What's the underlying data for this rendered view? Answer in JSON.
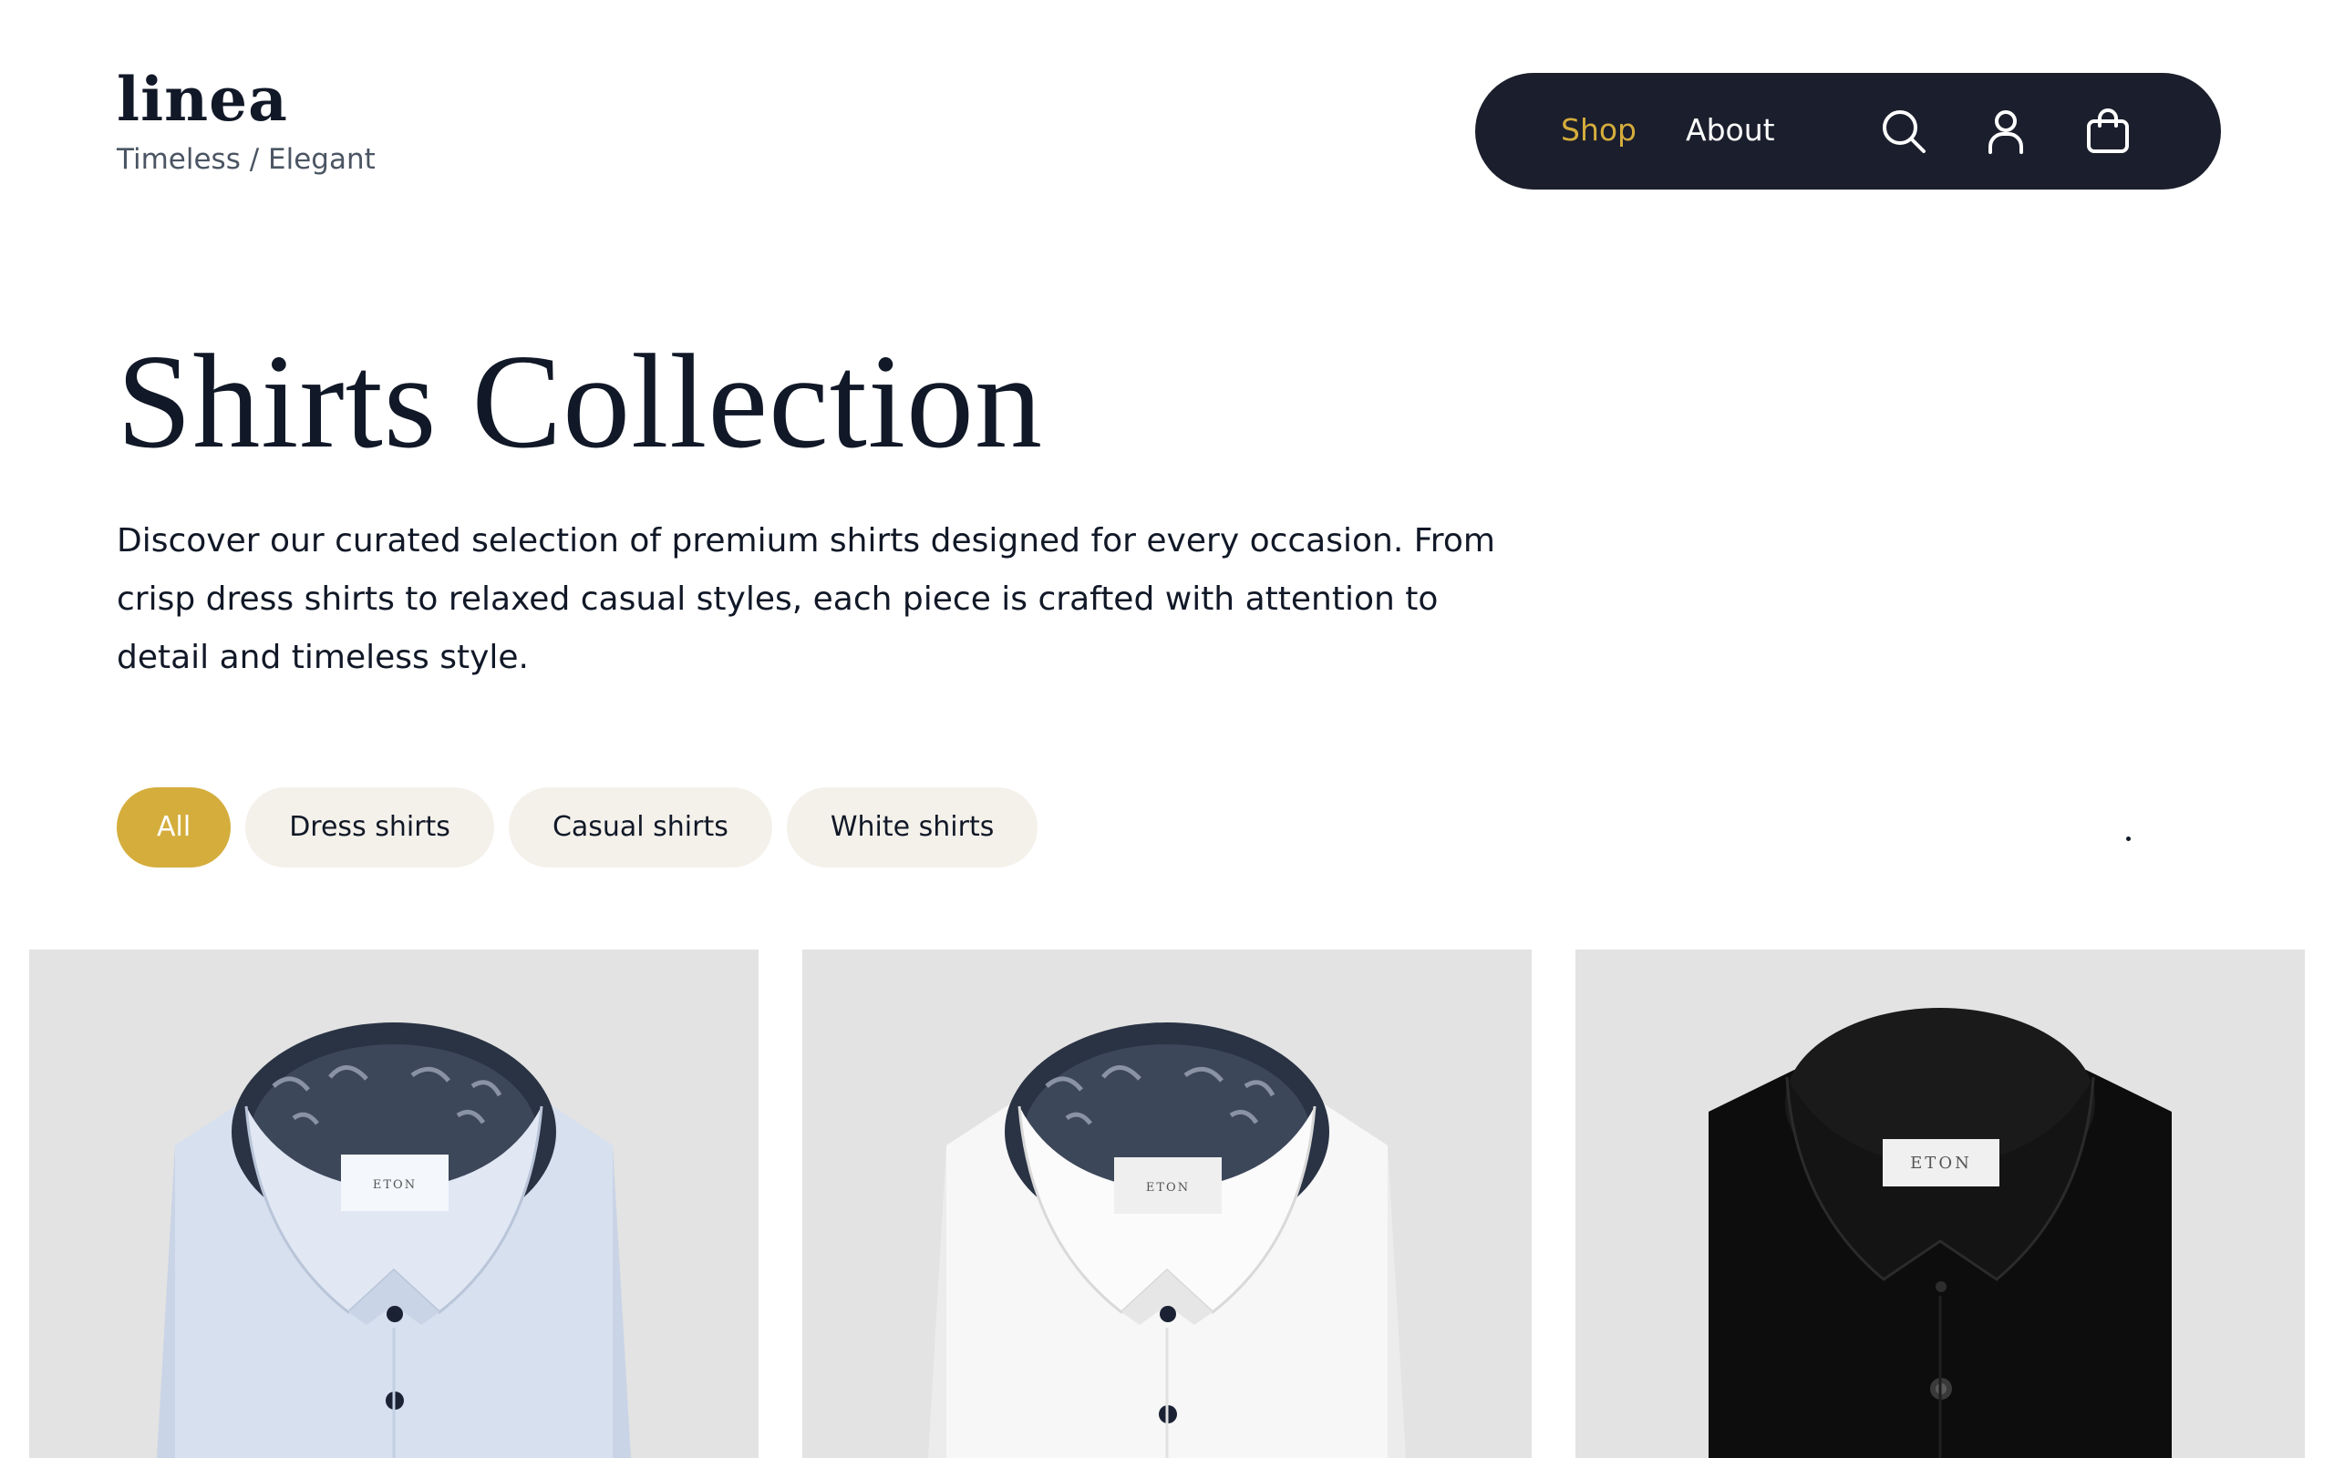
{
  "brand": {
    "name": "linea",
    "tagline": "Timeless / Elegant"
  },
  "nav": {
    "links": [
      {
        "label": "Shop",
        "active": true
      },
      {
        "label": "About",
        "active": false
      }
    ],
    "icons": [
      "search-icon",
      "user-icon",
      "shopping-bag-icon"
    ]
  },
  "hero": {
    "title": "Shirts Collection",
    "description": "Discover our curated selection of premium shirts designed for every occasion. From crisp dress shirts to relaxed casual styles, each piece is crafted with attention to detail and timeless style."
  },
  "filters": [
    {
      "label": "All",
      "active": true
    },
    {
      "label": "Dress shirts",
      "active": false
    },
    {
      "label": "Casual shirts",
      "active": false
    },
    {
      "label": "White shirts",
      "active": false
    }
  ],
  "products": [
    {
      "color_name": "light blue",
      "shirt_color": "#d6e0ef",
      "collar_pattern": "paisley",
      "label": "ETON"
    },
    {
      "color_name": "white",
      "shirt_color": "#f7f7f7",
      "collar_pattern": "paisley",
      "label": "ETON"
    },
    {
      "color_name": "black",
      "shirt_color": "#0d0d0d",
      "collar_pattern": "none",
      "label": "ETON"
    }
  ],
  "colors": {
    "accent": "#d4ad3c",
    "nav_background": "#1b1e2c",
    "chip_background": "#f4f1eb",
    "card_background": "#e3e3e3",
    "text": "#111827"
  }
}
